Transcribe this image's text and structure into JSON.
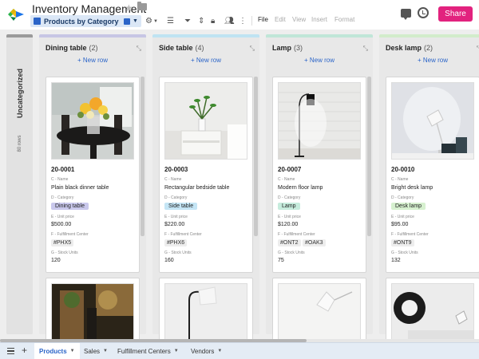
{
  "app": {
    "title": "Inventory Management",
    "view_name": "Products by Category",
    "menus": [
      "File",
      "Edit",
      "View",
      "Insert",
      "Format"
    ],
    "share_label": "Share",
    "accent": "#e2227e"
  },
  "uncategorized": {
    "label": "Uncategorized",
    "count": "80 rows"
  },
  "new_row_label": "+ New row",
  "field_labels": {
    "name": "C - Name",
    "category": "D - Category",
    "price": "E - Unit price",
    "fc": "F - Fulfillment Center",
    "stock": "G - Stock Units"
  },
  "columns": [
    {
      "name": "Dining table",
      "count": "(2)",
      "color": "#c7c6e4",
      "pill_color": "#c9c8ec",
      "card": {
        "id": "20-0001",
        "name": "Plain black dinner table",
        "category": "Dining table",
        "price": "$500.00",
        "fc": [
          "#PHX5"
        ],
        "stock": "120"
      }
    },
    {
      "name": "Side table",
      "count": "(4)",
      "color": "#bfe3f2",
      "pill_color": "#c4e5f5",
      "card": {
        "id": "20-0003",
        "name": "Rectangular bedside table",
        "category": "Side table",
        "price": "$220.00",
        "fc": [
          "#PHX6"
        ],
        "stock": "160"
      }
    },
    {
      "name": "Lamp",
      "count": "(3)",
      "color": "#c0e6d8",
      "pill_color": "#c6ecdd",
      "card": {
        "id": "20-0007",
        "name": "Modern floor lamp",
        "category": "Lamp",
        "price": "$120.00",
        "fc": [
          "#ONT2",
          "#OAK3"
        ],
        "stock": "75"
      }
    },
    {
      "name": "Desk lamp",
      "count": "(2)",
      "color": "#d2eccb",
      "pill_color": "#d6f0cf",
      "card": {
        "id": "20-0010",
        "name": "Bright desk lamp",
        "category": "Desk lamp",
        "price": "$95.00",
        "fc": [
          "#ONT9"
        ],
        "stock": "132"
      }
    }
  ],
  "sheet_tabs": [
    {
      "label": "Products",
      "active": true
    },
    {
      "label": "Sales",
      "active": false
    },
    {
      "label": "Fulfillment Centers",
      "active": false
    },
    {
      "label": "Vendors",
      "active": false
    }
  ]
}
